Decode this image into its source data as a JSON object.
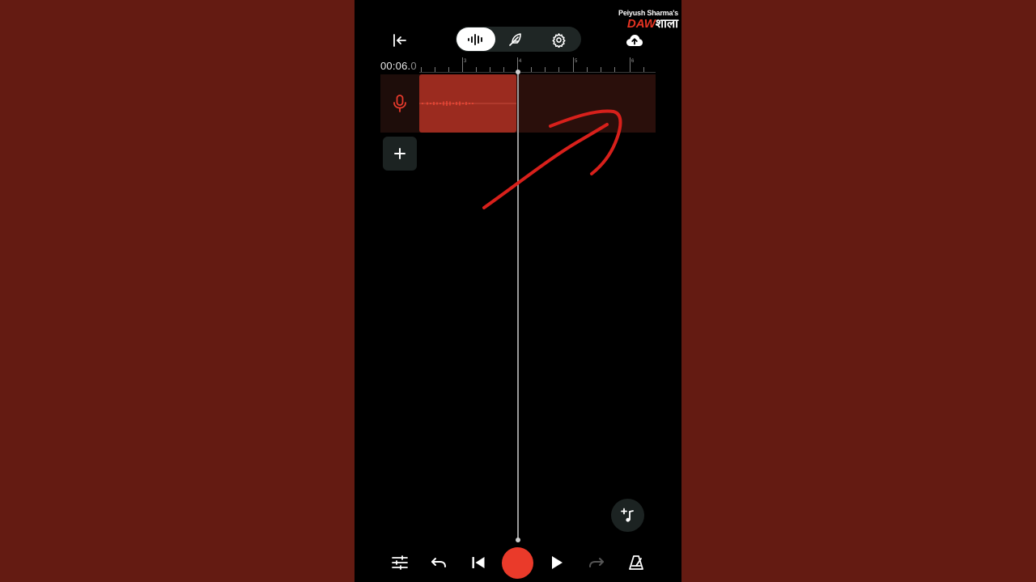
{
  "watermark": {
    "top": "Peiyush Sharma's",
    "daw": "DAW",
    "shala": "शाला"
  },
  "header": {
    "exit_icon": "exit-icon",
    "modes": [
      "waveform-icon",
      "feather-icon",
      "gear-icon"
    ],
    "active_mode": "waveform",
    "upload_icon": "cloud-upload-icon"
  },
  "timeline": {
    "time_main": "00:06.",
    "time_fade": "0",
    "bar_labels": [
      "3",
      "4",
      "5",
      "6"
    ]
  },
  "track": {
    "icon": "microphone-icon",
    "add_track_icon": "plus-icon"
  },
  "fab": {
    "icon": "add-music-icon"
  },
  "transport": {
    "icons": [
      "mixer-icon",
      "undo-icon",
      "skip-back-icon",
      "record-button",
      "play-icon",
      "redo-icon",
      "metronome-icon"
    ]
  },
  "colors": {
    "accent": "#ea3a2a",
    "clip": "#9b2b1f",
    "track_bg": "#2a0f0b",
    "background": "#000000",
    "frame": "#641b12",
    "annotation": "#d8201b"
  }
}
